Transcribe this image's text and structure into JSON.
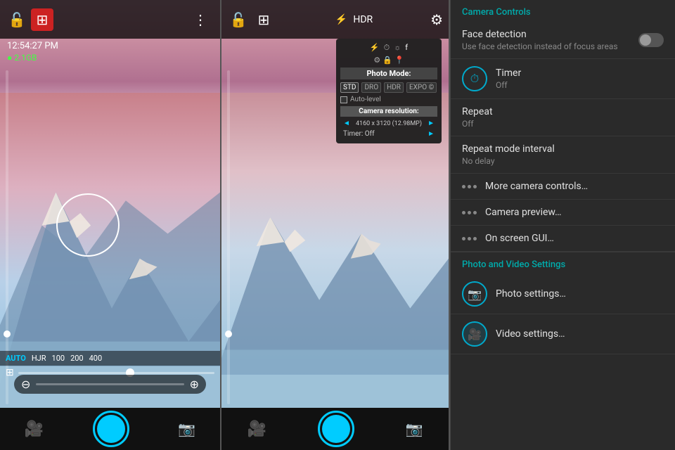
{
  "leftPanel": {
    "time": "12:54:27 PM",
    "storage": "● 2.1GB",
    "iso": {
      "auto_label": "AUTO",
      "values": [
        "HJR",
        "100",
        "200",
        "400"
      ]
    },
    "focus_circle": true
  },
  "rightPanel": {
    "dropdown": {
      "header": "Photo Mode:",
      "modes": [
        "STD",
        "DRO",
        "HDR",
        "EXPO ©"
      ],
      "auto_level": "Auto-level",
      "resolution_header": "Camera resolution:",
      "resolution_value": "◄ 4160 x 3120 (12.98MP) ►",
      "timer_row": "Timer: Off"
    }
  },
  "settingsPanel": {
    "section1_title": "Camera Controls",
    "face_detection_title": "Face detection",
    "face_detection_sub": "Use face detection instead of focus areas",
    "timer_title": "Timer",
    "timer_value": "Off",
    "repeat_title": "Repeat",
    "repeat_value": "Off",
    "repeat_interval_title": "Repeat mode interval",
    "repeat_interval_value": "No delay",
    "more_camera_label": "More camera controls…",
    "camera_preview_label": "Camera preview…",
    "on_screen_gui_label": "On screen GUI…",
    "section2_title": "Photo and Video Settings",
    "photo_settings_label": "Photo settings…",
    "video_settings_label": "Video settings…"
  }
}
